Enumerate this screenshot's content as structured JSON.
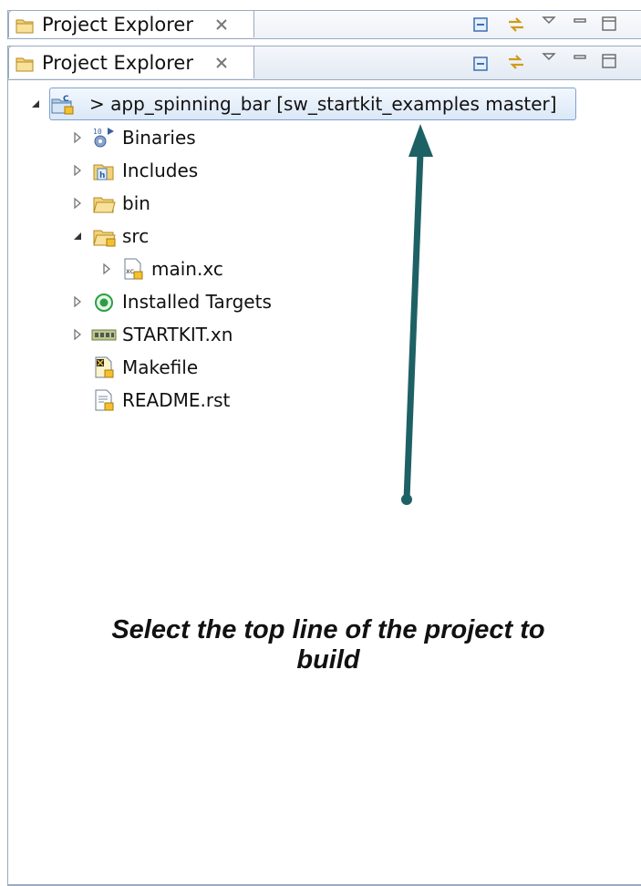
{
  "tabs": {
    "back": {
      "label": "Project Explorer"
    },
    "front": {
      "label": "Project Explorer"
    }
  },
  "tree": {
    "root": {
      "label": "> app_spinning_bar [sw_startkit_examples master]"
    },
    "items": [
      {
        "label": "Binaries",
        "icon": "binaries-icon"
      },
      {
        "label": "Includes",
        "icon": "includes-icon"
      },
      {
        "label": "bin",
        "icon": "folder-icon"
      },
      {
        "label": "src",
        "icon": "source-folder-icon"
      },
      {
        "label": "main.xc",
        "icon": "xc-file-icon"
      },
      {
        "label": "Installed Targets",
        "icon": "target-icon"
      },
      {
        "label": "STARTKIT.xn",
        "icon": "board-icon"
      },
      {
        "label": "Makefile",
        "icon": "makefile-icon"
      },
      {
        "label": "README.rst",
        "icon": "text-file-icon"
      }
    ]
  },
  "annotation": {
    "line1": "Select the top line of the project to",
    "line2": "build"
  },
  "colors": {
    "arrow": "#1e6165",
    "selection_border": "#7da2ce",
    "tab_border": "#9aaabf"
  }
}
